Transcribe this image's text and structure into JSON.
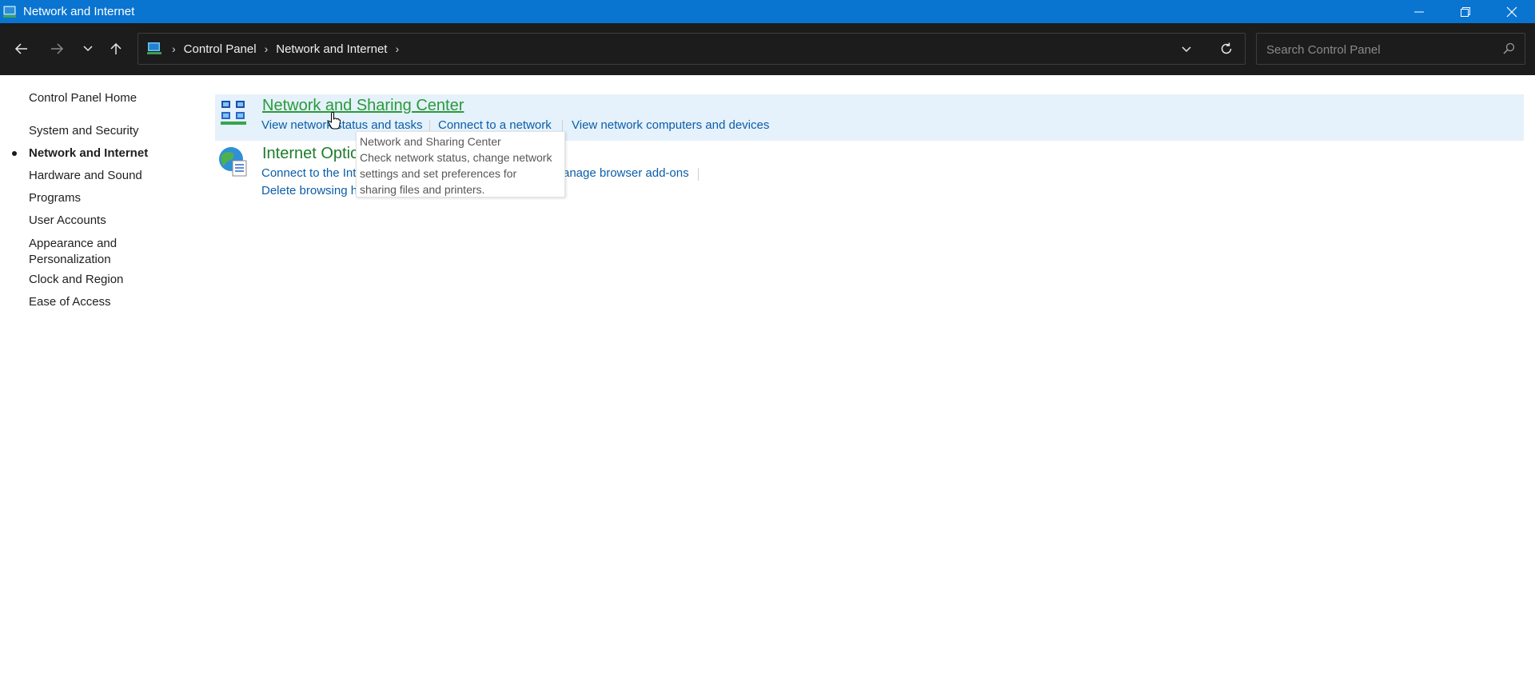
{
  "window": {
    "title": "Network and Internet",
    "minimize_icon": "minimize-icon",
    "restore_icon": "restore-icon",
    "close_icon": "close-icon"
  },
  "nav": {
    "back_icon": "back-arrow-icon",
    "forward_icon": "forward-arrow-icon",
    "recent_icon": "chevron-down-icon",
    "up_icon": "up-arrow-icon",
    "breadcrumbs": [
      "Control Panel",
      "Network and Internet"
    ],
    "refresh_icon": "refresh-icon",
    "search_placeholder": "Search Control Panel"
  },
  "sidebar": {
    "home": "Control Panel Home",
    "items": [
      {
        "label": "System and Security",
        "active": false
      },
      {
        "label": "Network and Internet",
        "active": true
      },
      {
        "label": "Hardware and Sound",
        "active": false
      },
      {
        "label": "Programs",
        "active": false
      },
      {
        "label": "User Accounts",
        "active": false
      },
      {
        "label": "Appearance and Personalization",
        "active": false
      },
      {
        "label": "Clock and Region",
        "active": false
      },
      {
        "label": "Ease of Access",
        "active": false
      }
    ],
    "appearance_line1": "Appearance and",
    "appearance_line2": "Personalization"
  },
  "categories": [
    {
      "title": "Network and Sharing Center",
      "links": [
        "View network status and tasks",
        "Connect to a network",
        "View network computers and devices"
      ]
    },
    {
      "title": "Internet Options",
      "links_visible": [
        "Connect to the Int",
        "anage browser add-ons",
        "Delete browsing h"
      ]
    }
  ],
  "tooltip": {
    "line1": "Network and Sharing Center",
    "line2": "Check network status, change network",
    "line3": "settings and set preferences for",
    "line4": "sharing files and printers."
  },
  "colors": {
    "titlebar": "#0a74d1",
    "navbar": "#1c1c1c",
    "category_title": "#1e7c2c",
    "link": "#0b5ea8",
    "highlight": "#e5f1fb"
  }
}
